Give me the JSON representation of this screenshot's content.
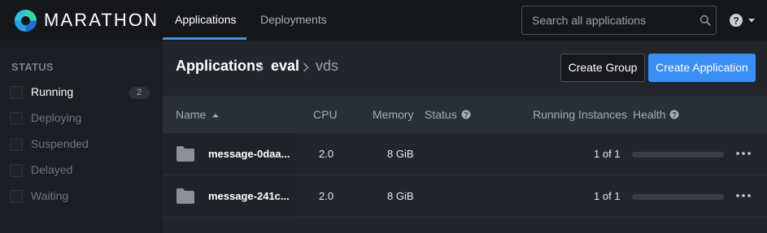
{
  "brand": {
    "name": "MARATHON"
  },
  "nav": {
    "tabs": [
      {
        "label": "Applications",
        "active": true
      },
      {
        "label": "Deployments",
        "active": false
      }
    ]
  },
  "search": {
    "placeholder": "Search all applications",
    "value": ""
  },
  "help": {
    "icon": "help-circle-icon"
  },
  "sidebar": {
    "title": "STATUS",
    "filters": [
      {
        "label": "Running",
        "count": "2"
      },
      {
        "label": "Deploying"
      },
      {
        "label": "Suspended"
      },
      {
        "label": "Delayed"
      },
      {
        "label": "Waiting"
      }
    ]
  },
  "breadcrumb": [
    "Applications",
    "eval",
    "vds"
  ],
  "actions": {
    "create_group": "Create Group",
    "create_application": "Create Application"
  },
  "table": {
    "columns": {
      "name": "Name",
      "cpu": "CPU",
      "memory": "Memory",
      "status": "Status",
      "instances": "Running Instances",
      "health": "Health"
    },
    "rows": [
      {
        "name": "message-0daa...",
        "cpu": "2.0",
        "memory": "8 GiB",
        "status": "",
        "instances": "1 of 1",
        "health": 0
      },
      {
        "name": "message-241c...",
        "cpu": "2.0",
        "memory": "8 GiB",
        "status": "",
        "instances": "1 of 1",
        "health": 0
      }
    ]
  },
  "colors": {
    "accent": "#3e92ea",
    "primary_button": "#3b8ef3",
    "navbar_bg": "#15171b",
    "main_bg": "#22252b",
    "logo": [
      "#2fd4a6",
      "#2a9ee8",
      "#1f6fd1"
    ]
  }
}
